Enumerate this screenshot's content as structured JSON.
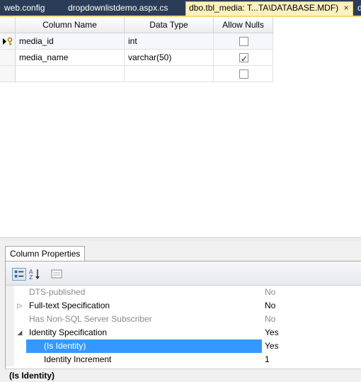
{
  "tabs": [
    {
      "label": "web.config",
      "active": false
    },
    {
      "label": "dropdownlistdemo.aspx.cs",
      "active": false
    },
    {
      "label": "dbo.tbl_media: T...TA\\DATABASE.MDF)",
      "active": true,
      "close": "×"
    },
    {
      "label": "d",
      "active": false
    }
  ],
  "grid": {
    "headers": {
      "column_name": "Column Name",
      "data_type": "Data Type",
      "allow_nulls": "Allow Nulls"
    },
    "rows": [
      {
        "column_name": "media_id",
        "data_type": "int",
        "allow_nulls": false,
        "primary_key": true,
        "current": true
      },
      {
        "column_name": "media_name",
        "data_type": "varchar(50)",
        "allow_nulls": true,
        "primary_key": false,
        "current": false
      },
      {
        "column_name": "",
        "data_type": "",
        "allow_nulls": false,
        "primary_key": false,
        "current": false
      }
    ]
  },
  "properties": {
    "tab_label": "Column Properties",
    "toolbar": {
      "categorized_icon": "categorized-icon",
      "alphabetical_icon": "alphabetical-sort-icon",
      "pages_icon": "property-pages-icon"
    },
    "rows": [
      {
        "name": "DTS-published",
        "value": "No",
        "dim": true,
        "expander": "",
        "indent": 0
      },
      {
        "name": "Full-text Specification",
        "value": "No",
        "dim": false,
        "expander": "▷",
        "indent": 0
      },
      {
        "name": "Has Non-SQL Server Subscriber",
        "value": "No",
        "dim": true,
        "expander": "",
        "indent": 0
      },
      {
        "name": "Identity Specification",
        "value": "Yes",
        "dim": false,
        "expander": "◢",
        "indent": 0
      },
      {
        "name": "(Is Identity)",
        "value": "Yes",
        "dim": false,
        "expander": "",
        "indent": 1,
        "selected": true
      },
      {
        "name": "Identity Increment",
        "value": "1",
        "dim": false,
        "expander": "",
        "indent": 1
      }
    ],
    "status_title": "(Is Identity)"
  },
  "colors": {
    "tabstrip": "#2b3c59",
    "active_tab": "#fdf1be",
    "selection": "#3399ff"
  }
}
